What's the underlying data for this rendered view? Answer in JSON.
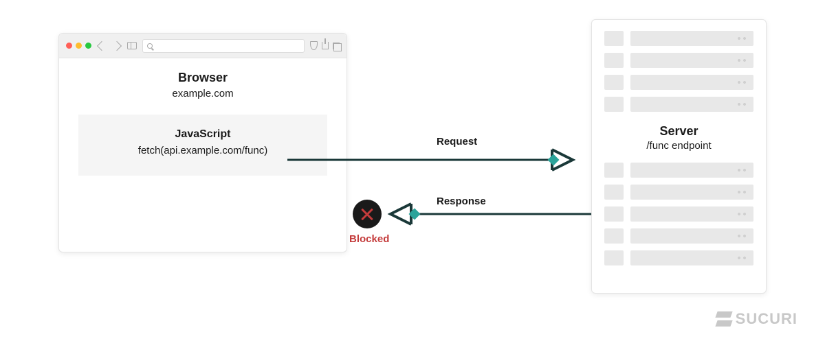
{
  "browser": {
    "title": "Browser",
    "domain": "example.com",
    "js_title": "JavaScript",
    "js_code": "fetch(api.example.com/func)"
  },
  "server": {
    "title": "Server",
    "endpoint": "/func endpoint"
  },
  "labels": {
    "request": "Request",
    "response": "Response",
    "blocked": "Blocked"
  },
  "branding": {
    "name": "SUCURI"
  },
  "colors": {
    "line": "#1a3838",
    "accent": "#2aa39a",
    "error": "#c43b3b"
  }
}
